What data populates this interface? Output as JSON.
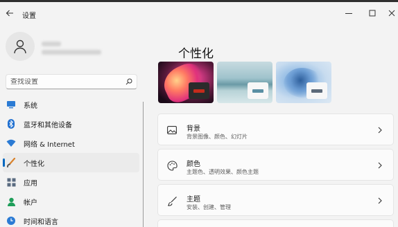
{
  "window": {
    "title": "设置"
  },
  "sidebar": {
    "search_placeholder": "查找设置",
    "items": [
      {
        "label": "系统",
        "icon": "monitor-icon"
      },
      {
        "label": "蓝牙和其他设备",
        "icon": "bluetooth-icon"
      },
      {
        "label": "网络 & Internet",
        "icon": "wifi-icon"
      },
      {
        "label": "个性化",
        "icon": "brush-icon",
        "active": true
      },
      {
        "label": "应用",
        "icon": "apps-icon"
      },
      {
        "label": "帐户",
        "icon": "account-icon"
      },
      {
        "label": "时间和语言",
        "icon": "globe-clock-icon"
      }
    ]
  },
  "main": {
    "page_title": "个性化",
    "themes": [
      {
        "name": "theme-dark-bloom",
        "accent": "#c42b1c"
      },
      {
        "name": "theme-lake",
        "accent": "#5a8fa3"
      },
      {
        "name": "theme-light-bloom",
        "accent": "#5c6a7a"
      }
    ],
    "cards": [
      {
        "title": "背景",
        "subtitle": "背景图像、颜色、幻灯片",
        "icon": "image-icon"
      },
      {
        "title": "颜色",
        "subtitle": "主题色、透明效果、颜色主题",
        "icon": "palette-icon"
      },
      {
        "title": "主题",
        "subtitle": "安装、创建、管理",
        "icon": "brush-icon"
      }
    ]
  },
  "colors": {
    "accent": "#0067c0",
    "window_bg": "#f3f3f3",
    "card_bg": "#fbfbfb"
  }
}
